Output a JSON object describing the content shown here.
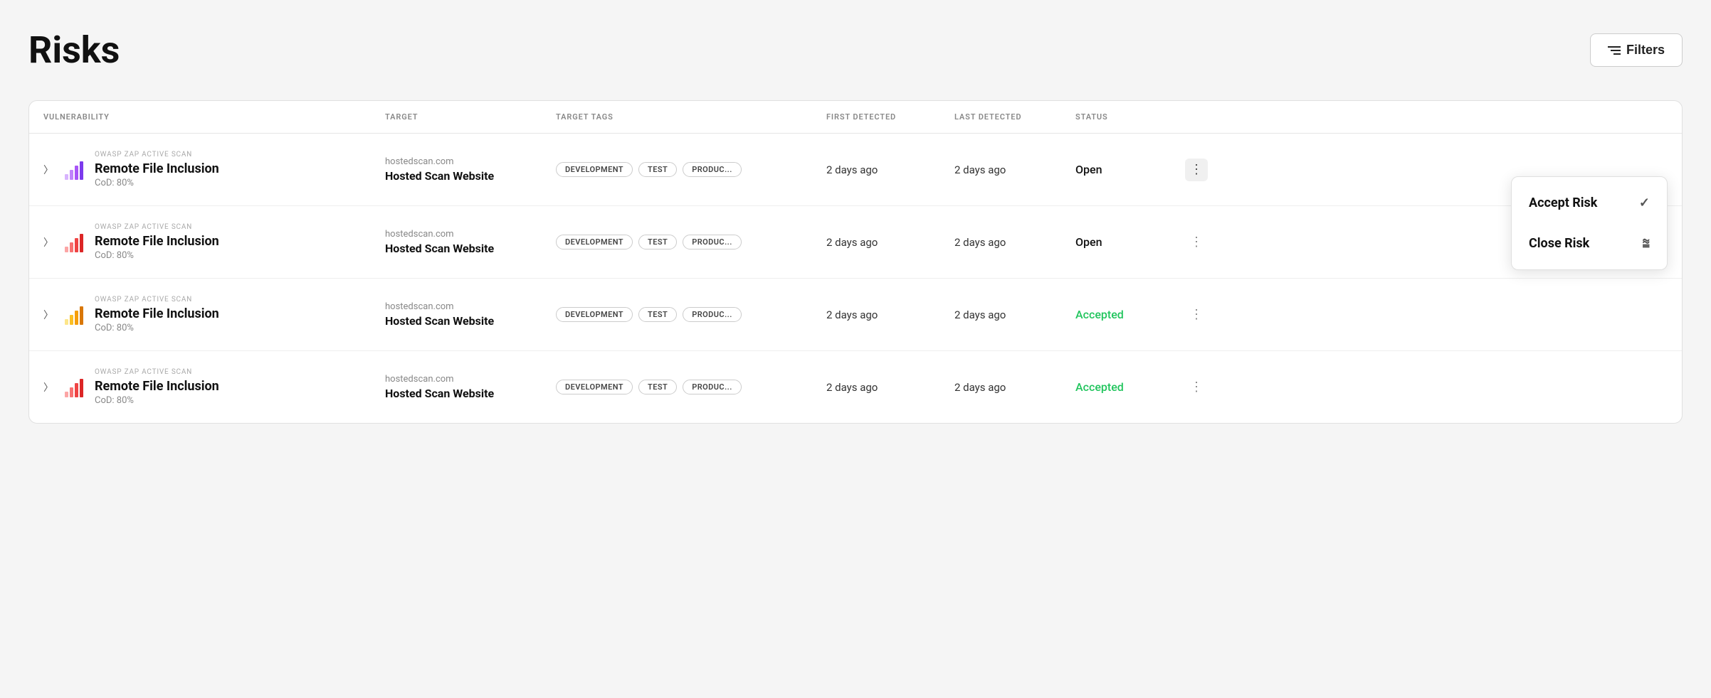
{
  "page": {
    "title": "Risks",
    "filters_button": "Filters"
  },
  "table": {
    "columns": [
      "VULNERABILITY",
      "TARGET",
      "TARGET TAGS",
      "FIRST DETECTED",
      "LAST DETECTED",
      "STATUS"
    ],
    "rows": [
      {
        "scanner": "OWASP ZAP ACTIVE SCAN",
        "vuln_name": "Remote File Inclusion",
        "cod": "CoD: 80%",
        "target_domain": "hostedscan.com",
        "target_name": "Hosted Scan Website",
        "tags": [
          "DEVELOPMENT",
          "TEST",
          "PRODUC..."
        ],
        "first_detected": "2 days ago",
        "last_detected": "2 days ago",
        "status": "Open",
        "status_type": "open",
        "bar_class": "bars-purple",
        "has_dropdown": true,
        "active_dropdown": true
      },
      {
        "scanner": "OWASP ZAP ACTIVE SCAN",
        "vuln_name": "Remote File Inclusion",
        "cod": "CoD: 80%",
        "target_domain": "hostedscan.com",
        "target_name": "Hosted Scan Website",
        "tags": [
          "DEVELOPMENT",
          "TEST",
          "PRODUC..."
        ],
        "first_detected": "2 days ago",
        "last_detected": "2 days ago",
        "status": "Open",
        "status_type": "open",
        "bar_class": "bars-red",
        "has_dropdown": false,
        "active_dropdown": false
      },
      {
        "scanner": "OWASP ZAP ACTIVE SCAN",
        "vuln_name": "Remote File Inclusion",
        "cod": "CoD: 80%",
        "target_domain": "hostedscan.com",
        "target_name": "Hosted Scan Website",
        "tags": [
          "DEVELOPMENT",
          "TEST",
          "PRODUC..."
        ],
        "first_detected": "2 days ago",
        "last_detected": "2 days ago",
        "status": "Accepted",
        "status_type": "accepted",
        "bar_class": "bars-yellow",
        "has_dropdown": false,
        "active_dropdown": false
      },
      {
        "scanner": "OWASP ZAP ACTIVE SCAN",
        "vuln_name": "Remote File Inclusion",
        "cod": "CoD: 80%",
        "target_domain": "hostedscan.com",
        "target_name": "Hosted Scan Website",
        "tags": [
          "DEVELOPMENT",
          "TEST",
          "PRODUC..."
        ],
        "first_detected": "2 days ago",
        "last_detected": "2 days ago",
        "status": "Accepted",
        "status_type": "accepted",
        "bar_class": "bars-red2",
        "has_dropdown": false,
        "active_dropdown": false
      }
    ],
    "dropdown": {
      "accept_risk_label": "Accept Risk",
      "close_risk_label": "Close Risk"
    }
  }
}
